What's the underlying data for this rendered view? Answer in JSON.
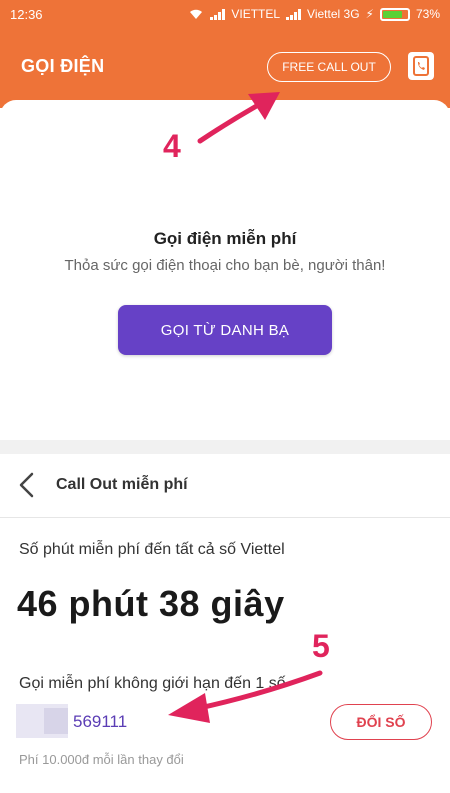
{
  "status": {
    "time": "12:36",
    "carrier1": "VIETTEL",
    "carrier2": "Viettel 3G",
    "battery": "73%",
    "battery_level": 0.73
  },
  "header": {
    "title": "GỌI ĐIỆN",
    "free_call_label": "FREE CALL OUT",
    "contact_icon": "contact-book-icon"
  },
  "free_call": {
    "heading": "Gọi điện miễn phí",
    "subheading": "Thỏa sức gọi điện thoại cho bạn bè, người thân!",
    "button_label": "GỌI TỪ DANH BẠ"
  },
  "callout": {
    "title": "Call Out miễn phí",
    "viettel_label": "Số phút miễn phí đến tất cả số Viettel",
    "minutes": "46 phút 38 giây",
    "unlimited_label": "Gọi miễn phí không giới hạn đến 1 số",
    "phone_number": "569111",
    "change_button": "ĐỔI SỐ",
    "fee_note": "Phí 10.000đ mỗi lần thay đổi"
  },
  "annotations": {
    "label_4": "4",
    "label_5": "5",
    "color": "#e0245c"
  },
  "colors": {
    "header": "#ee7338",
    "primary_button": "#6641c6",
    "change_button": "#e0424f"
  }
}
